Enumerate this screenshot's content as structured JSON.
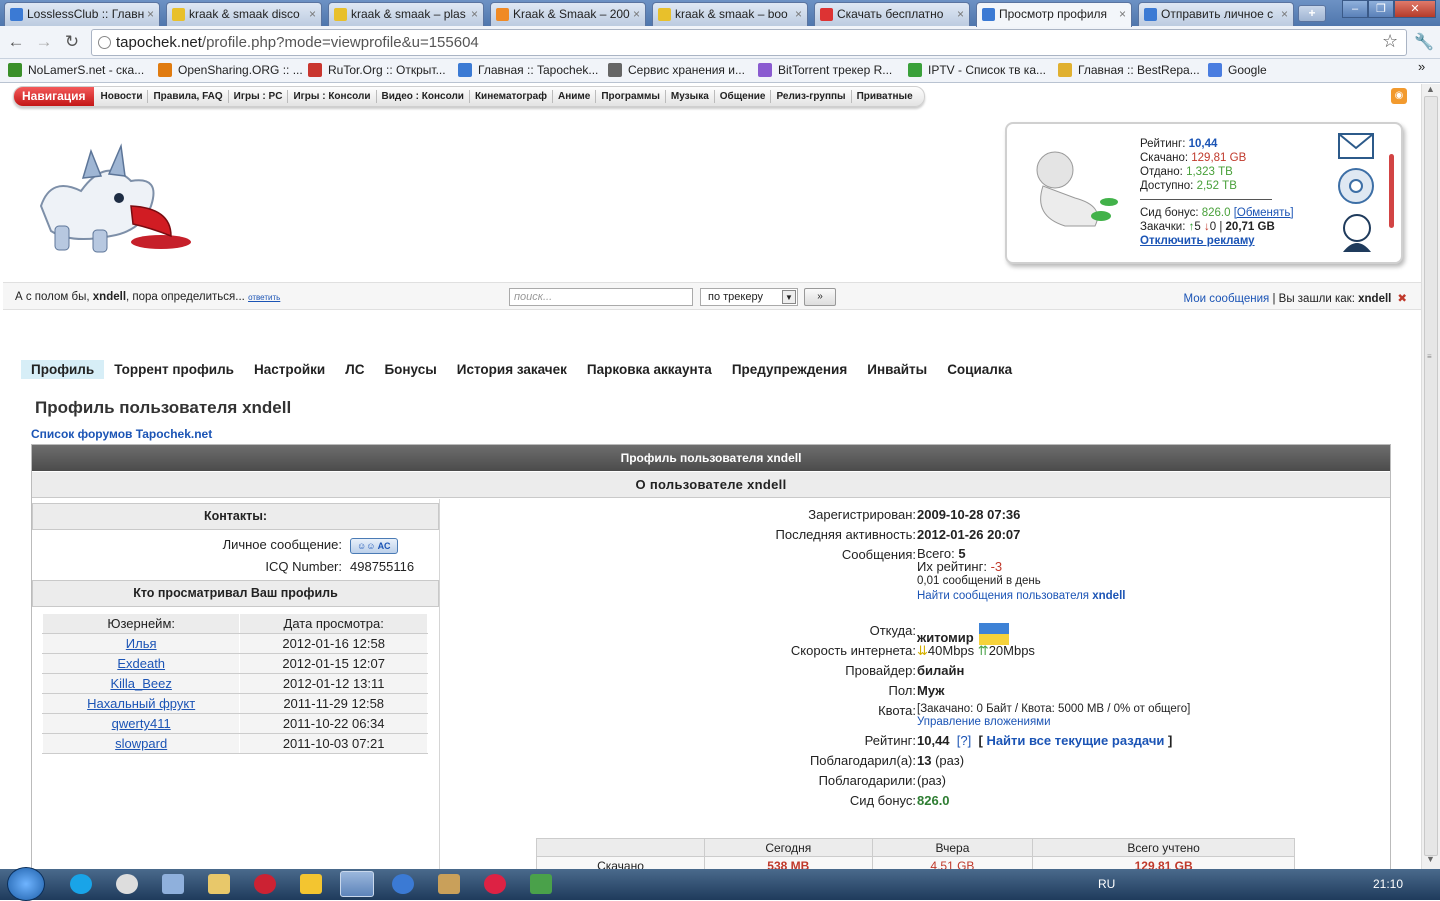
{
  "browser": {
    "tabs": [
      {
        "title": "LosslessClub :: Главн",
        "color": "#3b7ad4"
      },
      {
        "title": "kraak & smaak disco",
        "color": "#e8c02b"
      },
      {
        "title": "kraak & smaak – plas",
        "color": "#e8c02b"
      },
      {
        "title": "Kraak & Smaak – 200",
        "color": "#f08a24"
      },
      {
        "title": "kraak & smaak – boo",
        "color": "#e8c02b"
      },
      {
        "title": "Скачать бесплатно",
        "color": "#d33"
      },
      {
        "title": "Просмотр профиля",
        "color": "#3b7ad4"
      },
      {
        "title": "Отправить личное с",
        "color": "#3b7ad4"
      }
    ],
    "url_host": "tapochek.net",
    "url_path": "/profile.php?mode=viewprofile&u=155604",
    "bookmarks": [
      {
        "label": "NoLamerS.net - ска...",
        "color": "#3a8f2a"
      },
      {
        "label": "OpenSharing.ORG :: ...",
        "color": "#e07b10"
      },
      {
        "label": "RuTor.Org :: Открыт...",
        "color": "#c9362f"
      },
      {
        "label": "Главная :: Tapochek...",
        "color": "#3b7ad4"
      },
      {
        "label": "Сервис хранения и...",
        "color": "#666"
      },
      {
        "label": "BitTorrent трекер R...",
        "color": "#8a5bd0"
      },
      {
        "label": "IPTV - Список тв ка...",
        "color": "#3aa03a"
      },
      {
        "label": "Главная :: BestRepa...",
        "color": "#e0b030"
      },
      {
        "label": "Google",
        "color": "#4a7de0"
      }
    ]
  },
  "site": {
    "nav_lead": "Навигация",
    "nav": [
      "Новости",
      "Правила, FAQ",
      "Игры : PC",
      "Игры : Консоли",
      "Видео : Консоли",
      "Кинематограф",
      "Аниме",
      "Программы",
      "Музыка",
      "Общение",
      "Релиз-группы",
      "Приватные"
    ],
    "userbox": {
      "rating_label": "Рейтинг:",
      "rating": "10,44",
      "down_label": "Скачано:",
      "down": "129,81 GB",
      "up_label": "Отдано:",
      "up": "1,323 TB",
      "avail_label": "Доступно:",
      "avail": "2,52 TB",
      "seedbonus_label": "Сид бонус:",
      "seedbonus": "826.0",
      "exchange": "[Обменять]",
      "dl_label": "Закачки:",
      "dl_up": "5",
      "dl_down": "0",
      "dl_total": "20,71 GB",
      "ads": "Отключить рекламу"
    },
    "greeting": {
      "pre": "А с полом бы,",
      "user": "xndell",
      "post": ", пора определиться...",
      "answer": "ответить"
    },
    "search": {
      "placeholder": "поиск...",
      "scope": "по трекеру",
      "go": "»"
    },
    "messages_link": "Мои сообщения",
    "logged_as": "| Вы зашли как:",
    "login": "xndell"
  },
  "profile": {
    "tabs": [
      "Профиль",
      "Торрент профиль",
      "Настройки",
      "ЛС",
      "Бонусы",
      "История закачек",
      "Парковка аккаунта",
      "Предупреждения",
      "Инвайты",
      "Социалка"
    ],
    "title": "Профиль пользователя xndell",
    "forum_link": "Список форумов Tapochek.net",
    "header": "Профиль пользователя xndell",
    "about": "О пользователе xndell",
    "contacts_title": "Контакты:",
    "pm_label": "Личное сообщение:",
    "pm_button": "AC",
    "icq_label": "ICQ Number:",
    "icq": "498755116",
    "viewers_title": "Кто просматривал Ваш профиль",
    "viewers_cols": [
      "Юзернейм:",
      "Дата просмотра:"
    ],
    "viewers": [
      {
        "name": "Илья",
        "date": "2012-01-16 12:58"
      },
      {
        "name": "Exdeath",
        "date": "2012-01-15 12:07"
      },
      {
        "name": "Killa_Beez",
        "date": "2012-01-12 13:11"
      },
      {
        "name": "Нахальный фрукт",
        "date": "2011-11-29 12:58"
      },
      {
        "name": "qwerty411",
        "date": "2011-10-22 06:34"
      },
      {
        "name": "slowpard",
        "date": "2011-10-03 07:21"
      }
    ],
    "info": {
      "reg_label": "Зарегистрирован:",
      "reg": "2009-10-28 07:36",
      "last_label": "Последняя активность:",
      "last": "2012-01-26 20:07",
      "posts_label": "Сообщения:",
      "posts_total_label": "Всего:",
      "posts_total": "5",
      "posts_rating_label": "Их рейтинг:",
      "posts_rating": "-3",
      "posts_per_day": "0,01 сообщений в день",
      "find_posts": "Найти сообщения пользователя",
      "find_user": "xndell",
      "from_label": "Откуда:",
      "from": "житомир",
      "speed_label": "Скорость интернета:",
      "speed_down": "40Mbps",
      "speed_up": "20Mbps",
      "isp_label": "Провайдер:",
      "isp": "билайн",
      "sex_label": "Пол:",
      "sex": "Муж",
      "quota_label": "Квота:",
      "quota": "[Закачано: 0 Байт / Квота: 5000 MB / 0% от общего]",
      "attach": "Управление вложениями",
      "rating_label": "Рейтинг:",
      "rating": "10,44",
      "rating_help": "[?]",
      "all_releases": "Найти все текущие раздачи",
      "thanked_label": "Поблагодарил(а):",
      "thanked": "13",
      "thanked_unit": "(раз)",
      "thanks_label": "Поблагодарили:",
      "thanks_unit": "(раз)",
      "seed_label": "Сид бонус:",
      "seed": "826.0"
    },
    "stats": {
      "cols": [
        "Сегодня",
        "Вчера",
        "Всего учтено"
      ],
      "row_label": "Скачано",
      "today": "538 MB",
      "yesterday": "4,51 GB",
      "total": "129,81 GB"
    }
  },
  "taskbar": {
    "lang": "RU",
    "clock": "21:10"
  }
}
